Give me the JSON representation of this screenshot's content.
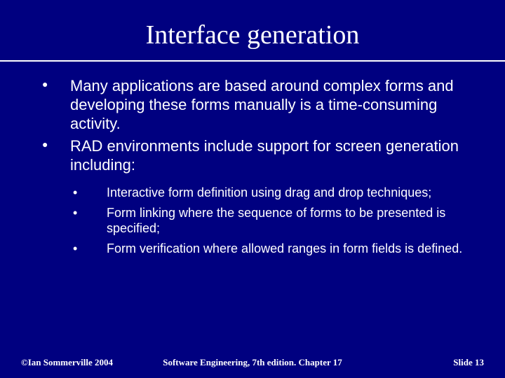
{
  "title": "Interface generation",
  "bullets": [
    "Many applications are based around complex forms and developing these forms manually is a time-consuming activity.",
    "RAD environments include support for screen generation including:"
  ],
  "sub_bullets": [
    "Interactive form definition using drag and drop techniques;",
    "Form linking where the sequence of forms to be presented is specified;",
    "Form verification where allowed ranges in form fields is defined."
  ],
  "footer": {
    "left": "©Ian Sommerville 2004",
    "center": "Software Engineering, 7th edition. Chapter 17",
    "right_label": "Slide ",
    "right_num": "13"
  }
}
